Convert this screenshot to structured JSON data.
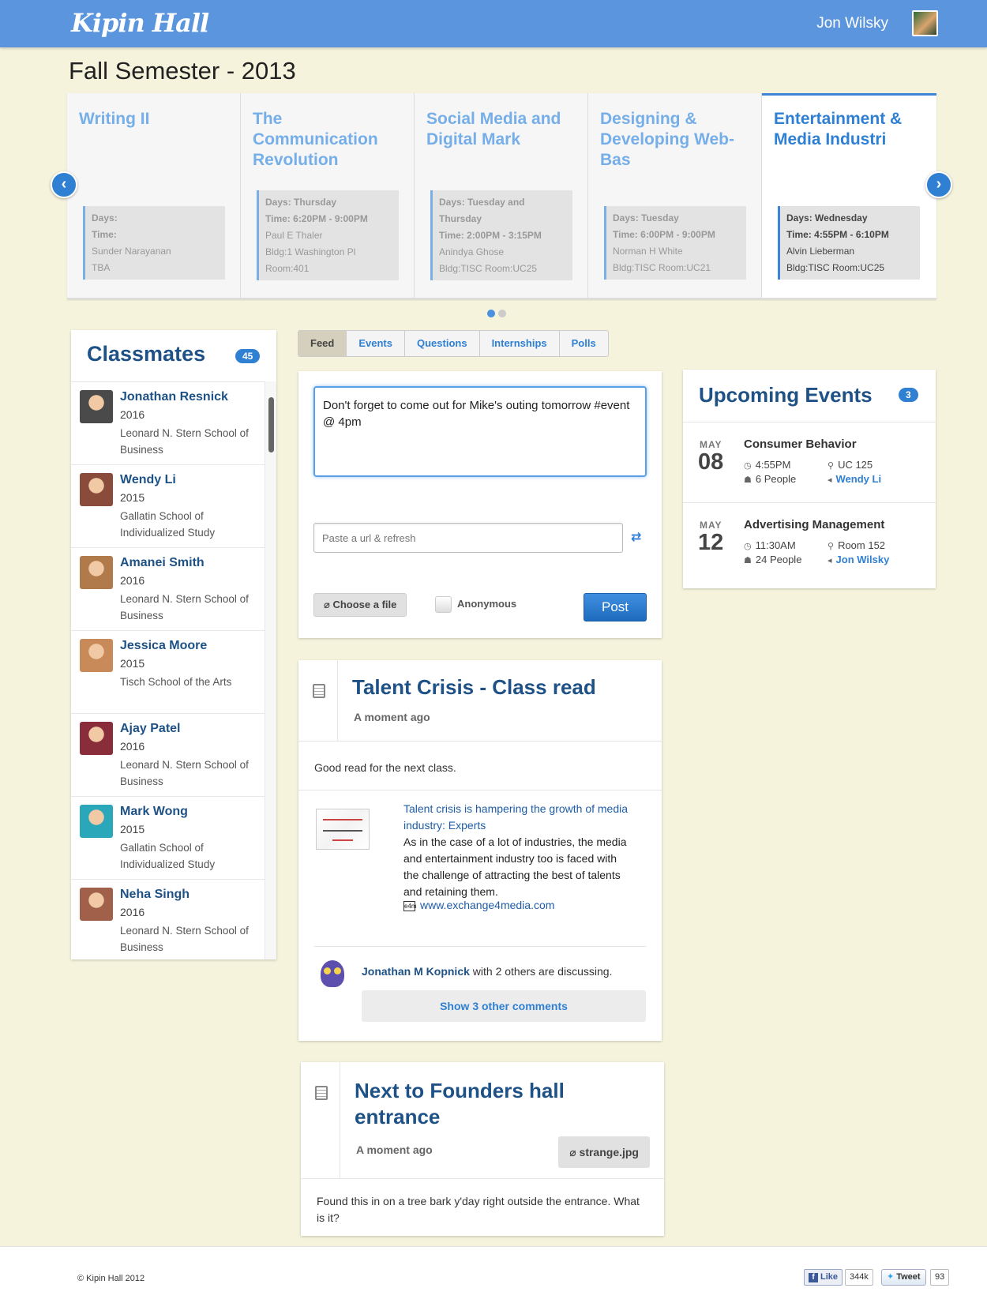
{
  "header": {
    "logo": "Kipin Hall",
    "user_name": "Jon Wilsky"
  },
  "page_title": "Fall Semester - 2013",
  "courses": [
    {
      "title": "Writing II",
      "days_label": "Days:",
      "days": "",
      "time_label": "Time:",
      "time": "",
      "instructor": "Sunder Narayanan",
      "location": "TBA"
    },
    {
      "title": "The Communication Revolution",
      "days_label": "Days:",
      "days": "Thursday",
      "time_label": "Time:",
      "time": "6:20PM - 9:00PM",
      "instructor": "Paul E Thaler",
      "location": "Bldg:1 Washington Pl Room:401"
    },
    {
      "title": "Social Media and Digital Mark",
      "days_label": "Days:",
      "days": "Tuesday and Thursday",
      "time_label": "Time:",
      "time": "2:00PM - 3:15PM",
      "instructor": "Anindya Ghose",
      "location": "Bldg:TISC  Room:UC25"
    },
    {
      "title": "Designing & Developing Web-Bas",
      "days_label": "Days:",
      "days": "Tuesday",
      "time_label": "Time:",
      "time": "6:00PM - 9:00PM",
      "instructor": "Norman H White",
      "location": "Bldg:TISC  Room:UC21"
    },
    {
      "title": "Entertainment & Media Industri",
      "days_label": "Days:",
      "days": "Wednesday",
      "time_label": "Time:",
      "time": "4:55PM - 6:10PM",
      "instructor": "Alvin Lieberman",
      "location": "Bldg:TISC  Room:UC25"
    }
  ],
  "carousel": {
    "prev_icon": "chevron-left-icon",
    "next_icon": "chevron-right-icon",
    "page": 1,
    "pages": 2
  },
  "classmates": {
    "title": "Classmates",
    "count": "45",
    "items": [
      {
        "name": "Jonathan Resnick",
        "year": "2016",
        "school": "Leonard N. Stern School of Business",
        "color": "#4a4a4a"
      },
      {
        "name": "Wendy Li",
        "year": "2015",
        "school": "Gallatin School of Individualized Study",
        "color": "#8a4b3a"
      },
      {
        "name": "Amanei Smith",
        "year": "2016",
        "school": "Leonard N. Stern School of Business",
        "color": "#b07a4a"
      },
      {
        "name": "Jessica Moore",
        "year": "2015",
        "school": "Tisch School of the Arts",
        "color": "#c98a5a"
      },
      {
        "name": "Ajay Patel",
        "year": "2016",
        "school": "Leonard N. Stern School of Business",
        "color": "#8a2d3a"
      },
      {
        "name": "Mark Wong",
        "year": "2015",
        "school": "Gallatin School of Individualized Study",
        "color": "#2aa7b8"
      },
      {
        "name": "Neha Singh",
        "year": "2016",
        "school": "Leonard N. Stern School of Business",
        "color": "#a0604a"
      }
    ]
  },
  "tabs": [
    "Feed",
    "Events",
    "Questions",
    "Internships",
    "Polls"
  ],
  "composer": {
    "text": "Don't forget to come out for Mike's outing tomorrow #event @ 4pm",
    "url_placeholder": "Paste a url & refresh",
    "file_button": "Choose a file",
    "anonymous_label": "Anonymous",
    "post_button": "Post"
  },
  "posts": [
    {
      "title": "Talent Crisis - Class read",
      "time": "A moment ago",
      "body": "Good read for the next class.",
      "link": {
        "title": "Talent crisis is hampering the growth of media industry: Experts",
        "description": "As in the case of a lot of industries, the media and entertainment industry too is faced with the challenge of attracting the best of talents and retaining them.",
        "favicon_text": "e4m",
        "url": "www.exchange4media.com"
      },
      "discussion": {
        "user": "Jonathan M Kopnick",
        "text": "with 2 others are discussing."
      },
      "show_comments": "Show 3 other comments"
    },
    {
      "title": "Next to Founders hall entrance",
      "time": "A moment ago",
      "attachment": "strange.jpg",
      "body": "Found this in on a tree bark y'day right outside the entrance. What is it?"
    }
  ],
  "events": {
    "title": "Upcoming Events",
    "count": "3",
    "items": [
      {
        "month": "MAY",
        "day": "08",
        "name": "Consumer Behavior",
        "time": "4:55PM",
        "location": "UC 125",
        "people": "6 People",
        "host": "Wendy Li"
      },
      {
        "month": "MAY",
        "day": "12",
        "name": "Advertising Management",
        "time": "11:30AM",
        "location": "Room 152",
        "people": "24 People",
        "host": "Jon Wilsky"
      }
    ]
  },
  "footer": {
    "copyright": "© Kipin Hall 2012",
    "like_label": "Like",
    "like_count": "344k",
    "tweet_label": "Tweet",
    "tweet_count": "93"
  },
  "colors": {
    "brand": "#5b95dd",
    "accent": "#2f7fd3",
    "heading": "#1e5186",
    "background": "#f5f3dc"
  }
}
